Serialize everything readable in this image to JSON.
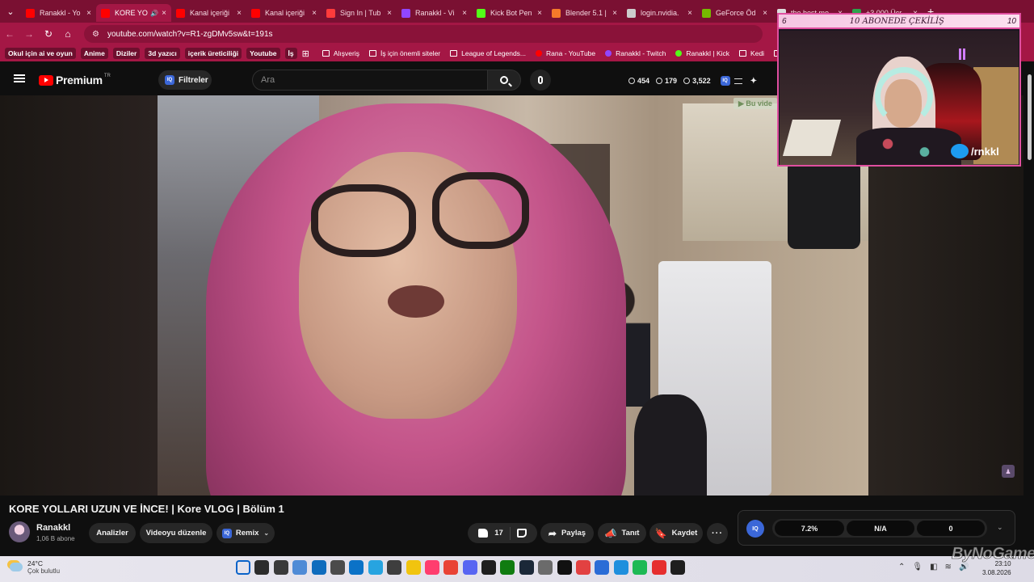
{
  "browser": {
    "tabs": [
      {
        "title": "Ranakkl - Yo",
        "fav": "#ff0000",
        "active": false
      },
      {
        "title": "KORE YO",
        "fav": "#ff0000",
        "active": true,
        "audio": true
      },
      {
        "title": "Kanal içeriği",
        "fav": "#ff0000",
        "active": false
      },
      {
        "title": "Kanal içeriği",
        "fav": "#ff0000",
        "active": false
      },
      {
        "title": "Sign In | Tub",
        "fav": "#ff3b3b",
        "active": false
      },
      {
        "title": "Ranakkl - Vi",
        "fav": "#9146ff",
        "active": false
      },
      {
        "title": "Kick Bot Pen",
        "fav": "#53fc18",
        "active": false
      },
      {
        "title": "Blender 5.1 |",
        "fav": "#f5792a",
        "active": false
      },
      {
        "title": "login.nvidia.",
        "fav": "#cccccc",
        "active": false
      },
      {
        "title": "GeForce Öd",
        "fav": "#76b900",
        "active": false
      },
      {
        "title": "the best mo",
        "fav": "#dddddd",
        "active": false
      },
      {
        "title": "+3.000 Ücr",
        "fav": "#2ca24c",
        "active": false
      }
    ],
    "close_glyph": "×",
    "new_tab_glyph": "+",
    "url": "youtube.com/watch?v=R1-zgDMv5sw&t=191s"
  },
  "bookmarks": {
    "chips": [
      "Okul için ai ve oyun",
      "Anime",
      "Diziler",
      "3d yazıcı",
      "içerik üreticiliği",
      "Youtube",
      "İş"
    ],
    "items": [
      {
        "label": "Alışveriş",
        "type": "folder"
      },
      {
        "label": "İş için önemli siteler",
        "type": "folder"
      },
      {
        "label": "League of Legends...",
        "type": "folder"
      },
      {
        "label": "Rana - YouTube",
        "type": "dot",
        "color": "#ff0000"
      },
      {
        "label": "Ranakkl - Twitch",
        "type": "dot",
        "color": "#9146ff"
      },
      {
        "label": "Ranakkl | Kick",
        "type": "dot",
        "color": "#53fc18"
      },
      {
        "label": "Kedi",
        "type": "folder"
      },
      {
        "label": "Tarifler",
        "type": "folder"
      }
    ]
  },
  "youtube": {
    "logo_text": "Premium",
    "country": "TR",
    "filters_label": "Filtreler",
    "iq_badge": "IQ",
    "search_placeholder": "Ara",
    "stats": [
      "454",
      "179",
      "3,522"
    ]
  },
  "video": {
    "notice": "▶ Bu vide",
    "title": "KORE YOLLARI UZUN VE İNCE! | Kore VLOG | Bölüm 1"
  },
  "channel": {
    "name": "Ranakkl",
    "subs": "1,06 B abone"
  },
  "actions": {
    "analytics": "Analizler",
    "edit": "Videoyu düzenle",
    "remix": "Remix",
    "likes": "17",
    "share": "Paylaş",
    "promote": "Tanıt",
    "save": "Kaydet"
  },
  "iq_stats": {
    "values": [
      "7.2%",
      "N/A",
      "0"
    ]
  },
  "overlay": {
    "left_count": "6",
    "title": "10 ABONEDE ÇEKİLİŞ",
    "right_count": "10",
    "twitter_handle": "/rnkkl"
  },
  "taskbar": {
    "temp": "24°C",
    "condition": "Çok bulutlu",
    "time": "23:10",
    "date": "3.08.2026",
    "icons": [
      "#0a63c9",
      "#2c2c2c",
      "#3a3a3a",
      "#4f8bd6",
      "#0f6cbd",
      "#4b4b4b",
      "#0b72c7",
      "#27a4e0",
      "#3e3e3e",
      "#f1c40f",
      "#ff3d6e",
      "#e94335",
      "#5865f2",
      "#1e1e1e",
      "#107c10",
      "#1b2838",
      "#6b6b6b",
      "#111111",
      "#e24141",
      "#2a6cd6",
      "#1f8fdd",
      "#1db954",
      "#e62e2e",
      "#1e1e1e"
    ]
  },
  "watermark": "ByNoGame"
}
